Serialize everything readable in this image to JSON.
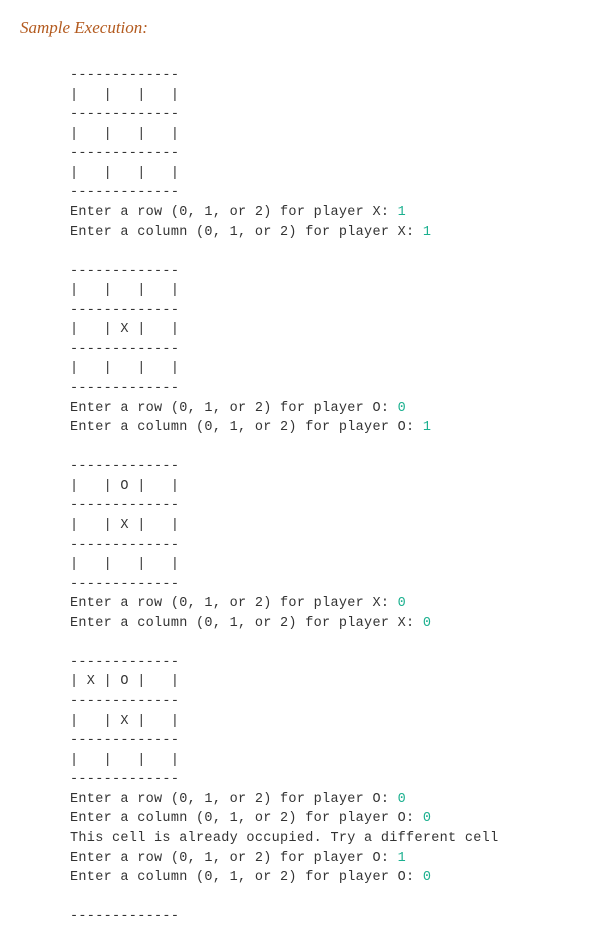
{
  "heading": "Sample Execution:",
  "lines": [
    {
      "t": "-------------"
    },
    {
      "t": "|   |   |   |"
    },
    {
      "t": "-------------"
    },
    {
      "t": "|   |   |   |"
    },
    {
      "t": "-------------"
    },
    {
      "t": "|   |   |   |"
    },
    {
      "t": "-------------"
    },
    {
      "t": "Enter a row (0, 1, or 2) for player X: ",
      "v": "1"
    },
    {
      "t": "Enter a column (0, 1, or 2) for player X: ",
      "v": "1"
    },
    {
      "blank": true
    },
    {
      "t": "-------------"
    },
    {
      "t": "|   |   |   |"
    },
    {
      "t": "-------------"
    },
    {
      "t": "|   | X |   |"
    },
    {
      "t": "-------------"
    },
    {
      "t": "|   |   |   |"
    },
    {
      "t": "-------------"
    },
    {
      "t": "Enter a row (0, 1, or 2) for player O: ",
      "v": "0"
    },
    {
      "t": "Enter a column (0, 1, or 2) for player O: ",
      "v": "1"
    },
    {
      "blank": true
    },
    {
      "t": "-------------"
    },
    {
      "t": "|   | O |   |"
    },
    {
      "t": "-------------"
    },
    {
      "t": "|   | X |   |"
    },
    {
      "t": "-------------"
    },
    {
      "t": "|   |   |   |"
    },
    {
      "t": "-------------"
    },
    {
      "t": "Enter a row (0, 1, or 2) for player X: ",
      "v": "0"
    },
    {
      "t": "Enter a column (0, 1, or 2) for player X: ",
      "v": "0"
    },
    {
      "blank": true
    },
    {
      "t": "-------------"
    },
    {
      "t": "| X | O |   |"
    },
    {
      "t": "-------------"
    },
    {
      "t": "|   | X |   |"
    },
    {
      "t": "-------------"
    },
    {
      "t": "|   |   |   |"
    },
    {
      "t": "-------------"
    },
    {
      "t": "Enter a row (0, 1, or 2) for player O: ",
      "v": "0"
    },
    {
      "t": "Enter a column (0, 1, or 2) for player O: ",
      "v": "0"
    },
    {
      "t": "This cell is already occupied. Try a different cell"
    },
    {
      "t": "Enter a row (0, 1, or 2) for player O: ",
      "v": "1"
    },
    {
      "t": "Enter a column (0, 1, or 2) for player O: ",
      "v": "0"
    },
    {
      "blank": true
    },
    {
      "t": "-------------"
    }
  ]
}
